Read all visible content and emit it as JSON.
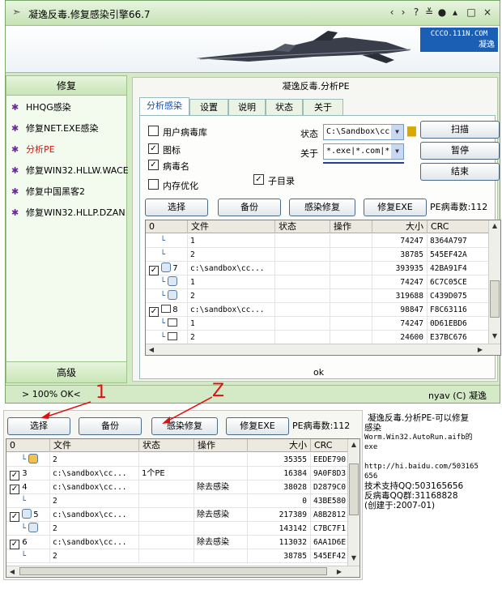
{
  "window": {
    "title": "凝逸反毒.修复感染引擎66.7",
    "controls": [
      "‹",
      "›",
      "?",
      "≚",
      "●",
      "▴",
      "□",
      "×"
    ]
  },
  "banner": {
    "logo_line1": "CCCO.111N.COM",
    "logo_line2": "凝逸"
  },
  "left_panel": {
    "header": "修复",
    "items": [
      {
        "label": "HHQG感染",
        "active": false
      },
      {
        "label": "修复NET.EXE感染",
        "active": false
      },
      {
        "label": "分析PE",
        "active": true
      },
      {
        "label": "修复WIN32.HLLW.WACE",
        "active": false
      },
      {
        "label": "修复中国黑客2",
        "active": false
      },
      {
        "label": "修复WIN32.HLLP.DZAN",
        "active": false
      }
    ],
    "footer": "高级"
  },
  "right_panel": {
    "title": "凝逸反毒.分析PE",
    "tabs": [
      "分析感染",
      "设置",
      "说明",
      "状态",
      "关于"
    ],
    "options": {
      "user_db": {
        "label": "用户病毒库",
        "checked": false
      },
      "icon": {
        "label": "图标",
        "checked": true
      },
      "virus_name": {
        "label": "病毒名",
        "checked": true
      },
      "mem_opt": {
        "label": "内存优化",
        "checked": false
      },
      "subdir": {
        "label": "子目录",
        "checked": true
      }
    },
    "status_label": "状态",
    "status_value": "C:\\Sandbox\\cc",
    "about_label": "关于",
    "about_value": "*.exe|*.com|*",
    "buttons": {
      "scan": "扫描",
      "pause": "暂停",
      "end": "结束"
    },
    "actions": {
      "select": "选择",
      "backup": "备份",
      "repair": "感染修复",
      "repair_exe": "修复EXE"
    },
    "pe_count": "PE病毒数:112",
    "columns": [
      "0",
      "文件",
      "状态",
      "操作",
      "大小",
      "CRC"
    ],
    "rows": [
      {
        "checkbox": false,
        "icon": "tree",
        "index": "",
        "file": "1",
        "status": "",
        "op": "",
        "size": "74247",
        "crc": "8364A797"
      },
      {
        "checkbox": false,
        "icon": "tree",
        "index": "",
        "file": "2",
        "status": "",
        "op": "",
        "size": "38785",
        "crc": "545EF42A"
      },
      {
        "checkbox": true,
        "icon": "recycle",
        "index": "7",
        "file": "c:\\sandbox\\cc...",
        "status": "",
        "op": "",
        "size": "393935",
        "crc": "42BA91F4"
      },
      {
        "checkbox": false,
        "icon": "tree-recycle",
        "index": "",
        "file": "1",
        "status": "",
        "op": "",
        "size": "74247",
        "crc": "6C7C05CE"
      },
      {
        "checkbox": false,
        "icon": "tree-recycle",
        "index": "",
        "file": "2",
        "status": "",
        "op": "",
        "size": "319688",
        "crc": "C439D075"
      },
      {
        "checkbox": true,
        "icon": "folder",
        "index": "8",
        "file": "c:\\sandbox\\cc...",
        "status": "",
        "op": "",
        "size": "98847",
        "crc": "F8C63116"
      },
      {
        "checkbox": false,
        "icon": "tree-folder",
        "index": "",
        "file": "1",
        "status": "",
        "op": "",
        "size": "74247",
        "crc": "0D61EBD6"
      },
      {
        "checkbox": false,
        "icon": "tree-folder",
        "index": "",
        "file": "2",
        "status": "",
        "op": "",
        "size": "24600",
        "crc": "E37BC676"
      }
    ],
    "ok_text": "ok"
  },
  "statusbar": {
    "left": "> 100% OK<",
    "right": "nyav (C) 凝逸"
  },
  "bottom": {
    "actions": {
      "select": "选择",
      "backup": "备份",
      "repair": "感染修复",
      "repair_exe": "修复EXE"
    },
    "pe_count": "PE病毒数:112",
    "columns": [
      "0",
      "文件",
      "状态",
      "操作",
      "大小",
      "CRC"
    ],
    "rows": [
      {
        "checkbox": false,
        "icon": "tree-special",
        "index": "",
        "file": "2",
        "status": "",
        "op": "",
        "size": "35355",
        "crc": "EEDE790"
      },
      {
        "checkbox": true,
        "icon": "none",
        "index": "3",
        "file": "c:\\sandbox\\cc...",
        "status": "1个PE",
        "op": "",
        "size": "16384",
        "crc": "9A0F8D3"
      },
      {
        "checkbox": true,
        "icon": "none",
        "index": "4",
        "file": "c:\\sandbox\\cc...",
        "status": "",
        "op": "除去感染",
        "size": "38028",
        "crc": "D2879C0"
      },
      {
        "checkbox": false,
        "icon": "tree",
        "index": "",
        "file": "2",
        "status": "",
        "op": "",
        "size": "0",
        "crc": "43BE580"
      },
      {
        "checkbox": true,
        "icon": "recycle",
        "index": "5",
        "file": "c:\\sandbox\\cc...",
        "status": "",
        "op": "除去感染",
        "size": "217389",
        "crc": "A8B2812"
      },
      {
        "checkbox": false,
        "icon": "tree-recycle",
        "index": "",
        "file": "2",
        "status": "",
        "op": "",
        "size": "143142",
        "crc": "C7BC7F1"
      },
      {
        "checkbox": true,
        "icon": "none",
        "index": "6",
        "file": "c:\\sandbox\\cc...",
        "status": "",
        "op": "除去感染",
        "size": "113032",
        "crc": "6AA1D6E"
      },
      {
        "checkbox": false,
        "icon": "tree",
        "index": "",
        "file": "2",
        "status": "",
        "op": "",
        "size": "38785",
        "crc": "545EF42"
      }
    ],
    "note": {
      "line1": "凝逸反毒.分析PE-可以修复",
      "line2": "感染",
      "line3": "Worm.Win32.AutoRun.aifb的",
      "line4": "exe",
      "url": "http://hi.baidu.com/503165",
      "url2": "656",
      "support": "技术支持QQ:503165656",
      "group": "反病毒QQ群:31168828",
      "created": "(创建于:2007-01)"
    }
  },
  "annotations": {
    "one": "1",
    "two": "Z"
  },
  "colors": {
    "annotation": "#e01010",
    "active_item": "#e01010",
    "tab_active": "#1a4fb0",
    "window_bg": "#d4e9c6"
  }
}
